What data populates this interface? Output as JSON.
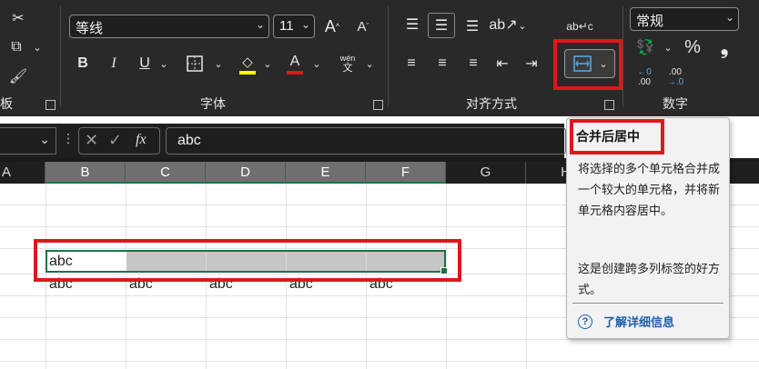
{
  "ribbon": {
    "clipboard": {
      "label_partial": "板"
    },
    "font": {
      "label": "字体",
      "font_name": "等线",
      "font_size": "11",
      "wen_top": "wén",
      "wen_bottom": "文"
    },
    "alignment": {
      "label": "对齐方式",
      "merge_center_tooltip_anchor": "合并后居中"
    },
    "number": {
      "label": "数字",
      "format": "常规",
      "dec_increase_top": "←0",
      "dec_increase_bottom": ".00",
      "dec_decrease_top": ".00",
      "dec_decrease_bottom": "→.0"
    }
  },
  "formula_bar": {
    "fx": "fx",
    "content": "abc"
  },
  "columns": [
    "A",
    "B",
    "C",
    "D",
    "E",
    "F",
    "G",
    "H"
  ],
  "cells": {
    "b5": "abc",
    "row6": [
      "abc",
      "abc",
      "abc",
      "abc",
      "abc"
    ]
  },
  "tooltip": {
    "title": "合并后居中",
    "para1": "将选择的多个单元格合并成一个较大的单元格，并将新单元格内容居中。",
    "para2": "这是创建跨多列标签的好方式。",
    "link": "了解详细信息"
  },
  "colors": {
    "accent_green": "#1e7145",
    "highlight_red": "#e0161e",
    "link_blue": "#1f5fa8"
  }
}
